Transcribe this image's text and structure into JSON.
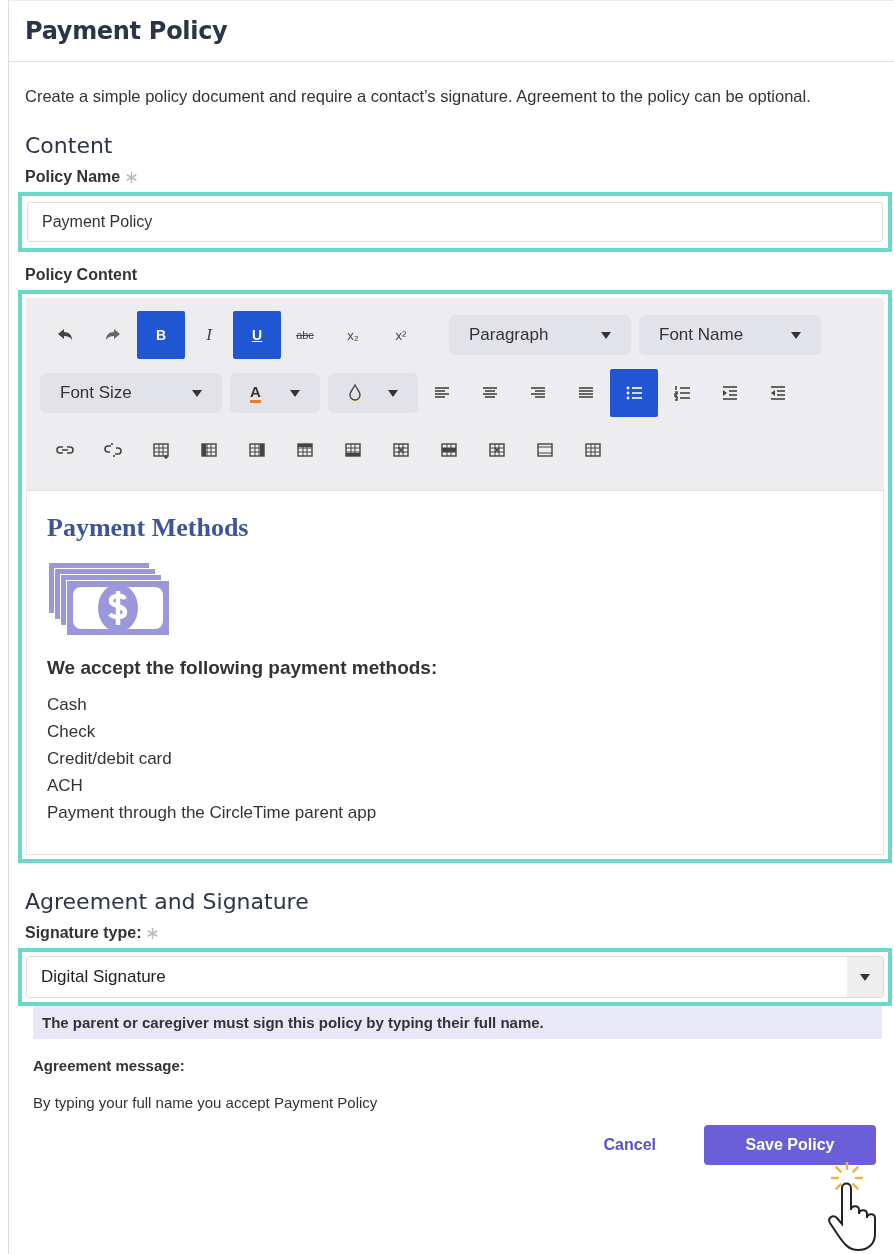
{
  "header": {
    "title": "Payment Policy"
  },
  "description": "Create a simple policy document and require a contact’s signature. Agreement to the policy can be optional.",
  "content_section": {
    "heading": "Content"
  },
  "policy_name": {
    "label": "Policy Name",
    "required": true,
    "value": "Payment Policy",
    "highlighted": true
  },
  "policy_content": {
    "label": "Policy Content",
    "highlighted": true,
    "toolbar": [
      [
        {
          "kind": "undo",
          "selected": false
        },
        {
          "kind": "redo",
          "selected": false
        },
        {
          "kind": "bold",
          "label": "B",
          "selected": true
        },
        {
          "kind": "italic",
          "label": "I",
          "selected": false
        },
        {
          "kind": "underline",
          "label": "U",
          "selected": true
        },
        {
          "kind": "strike",
          "label": "abc",
          "selected": false
        },
        {
          "kind": "sub",
          "label": "x₂",
          "selected": false
        },
        {
          "kind": "super",
          "label": "x²",
          "selected": false
        },
        {
          "kind": "select",
          "label": "Paragraph"
        },
        {
          "kind": "select",
          "label": "Font Name"
        }
      ],
      [
        {
          "kind": "select",
          "label": "Font Size"
        },
        {
          "kind": "font-color",
          "label": "A"
        },
        {
          "kind": "highlight"
        },
        {
          "kind": "align-left",
          "selected": false
        },
        {
          "kind": "align-center",
          "selected": false
        },
        {
          "kind": "align-right",
          "selected": false
        },
        {
          "kind": "justify",
          "selected": false
        },
        {
          "kind": "bullets",
          "selected": true
        },
        {
          "kind": "numbers",
          "selected": false
        },
        {
          "kind": "indent",
          "selected": false
        },
        {
          "kind": "outdent",
          "selected": false
        }
      ],
      [
        {
          "kind": "link"
        },
        {
          "kind": "unlink"
        },
        {
          "kind": "table"
        },
        {
          "kind": "col-before"
        },
        {
          "kind": "col-after"
        },
        {
          "kind": "row-before"
        },
        {
          "kind": "row-after"
        },
        {
          "kind": "delete-col"
        },
        {
          "kind": "delete-row"
        },
        {
          "kind": "delete-table"
        },
        {
          "kind": "cell-props"
        },
        {
          "kind": "table-props"
        }
      ]
    ],
    "body": {
      "heading": "Payment Methods",
      "subheading": "We accept the following payment methods:",
      "lines": [
        "Cash",
        "Check",
        "Credit/debit card",
        "ACH",
        "Payment through the CircleTime parent app"
      ]
    }
  },
  "agreement_section": {
    "heading": "Agreement and Signature"
  },
  "signature_type": {
    "label": "Signature type:",
    "required": true,
    "value": "Digital Signature",
    "highlighted": true,
    "hint": "The parent or caregiver must sign this policy by typing their full name."
  },
  "agreement_message": {
    "label": "Agreement message:",
    "text": "By typing your full name you accept Payment Policy"
  },
  "buttons": [
    {
      "kind": "link",
      "label": "Cancel"
    },
    {
      "kind": "primary",
      "label": "Save Policy"
    }
  ]
}
